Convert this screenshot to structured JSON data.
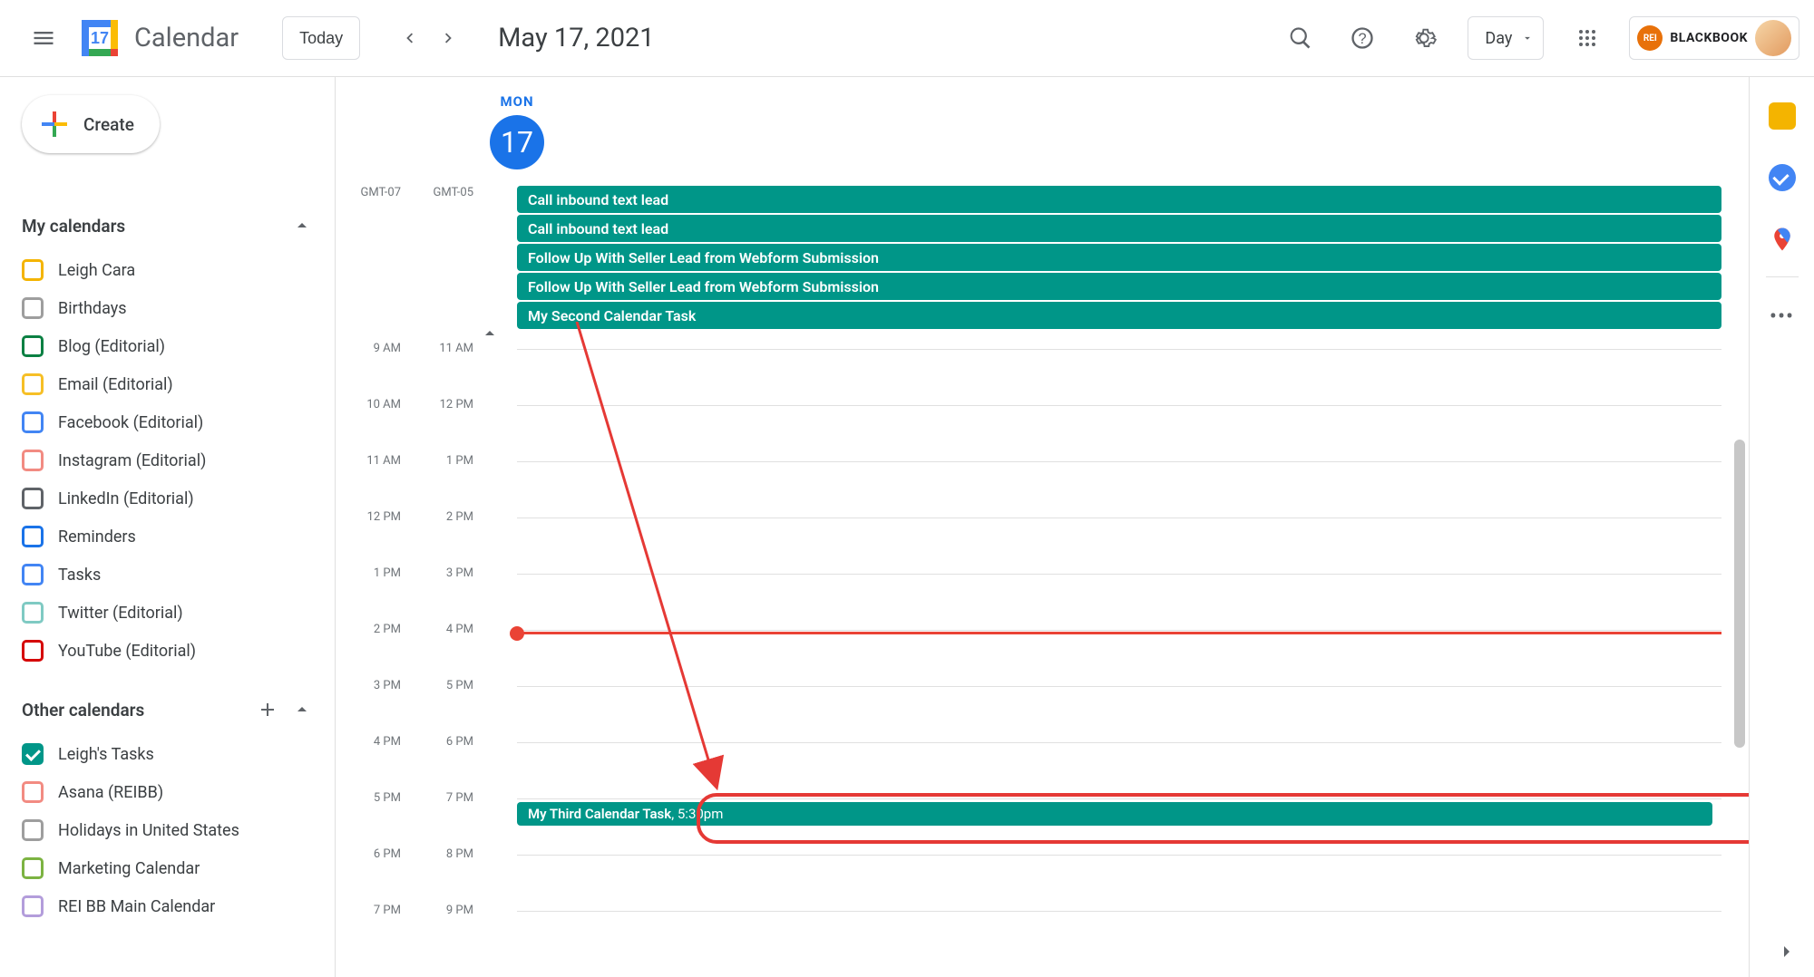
{
  "header": {
    "app_name": "Calendar",
    "today_label": "Today",
    "date_title": "May 17, 2021",
    "view_label": "Day",
    "account_brand": "BLACKBOOK",
    "account_badge": "REI"
  },
  "create_label": "Create",
  "sidebar": {
    "my_calendars_title": "My calendars",
    "other_calendars_title": "Other calendars",
    "my_calendars": [
      {
        "label": "Leigh Cara",
        "color": "#f4b400",
        "checked": false
      },
      {
        "label": "Birthdays",
        "color": "#9e9e9e",
        "checked": false
      },
      {
        "label": "Blog (Editorial)",
        "color": "#0b8043",
        "checked": false
      },
      {
        "label": "Email (Editorial)",
        "color": "#f6bf26",
        "checked": false
      },
      {
        "label": "Facebook (Editorial)",
        "color": "#4285f4",
        "checked": false
      },
      {
        "label": "Instagram (Editorial)",
        "color": "#f28b82",
        "checked": false
      },
      {
        "label": "LinkedIn (Editorial)",
        "color": "#5f6368",
        "checked": false
      },
      {
        "label": "Reminders",
        "color": "#1a73e8",
        "checked": false
      },
      {
        "label": "Tasks",
        "color": "#4285f4",
        "checked": false
      },
      {
        "label": "Twitter (Editorial)",
        "color": "#7fcac3",
        "checked": false
      },
      {
        "label": "YouTube (Editorial)",
        "color": "#d50000",
        "checked": false
      }
    ],
    "other_calendars": [
      {
        "label": "Leigh's Tasks",
        "color": "#009688",
        "checked": true
      },
      {
        "label": "Asana (REIBB)",
        "color": "#f28b82",
        "checked": false
      },
      {
        "label": "Holidays in United States",
        "color": "#9e9e9e",
        "checked": false
      },
      {
        "label": "Marketing Calendar",
        "color": "#7cb342",
        "checked": false
      },
      {
        "label": "REI BB Main Calendar",
        "color": "#b39ddb",
        "checked": false
      }
    ]
  },
  "day": {
    "dow": "MON",
    "dom": "17",
    "tz1": "GMT-07",
    "tz2": "GMT-05",
    "allday_events": [
      "Call inbound text lead",
      "Call inbound text lead",
      "Follow Up With Seller Lead from Webform Submission",
      "Follow Up With Seller Lead from Webform Submission",
      "My Second Calendar Task"
    ],
    "hours_col1": [
      "9 AM",
      "10 AM",
      "11 AM",
      "12 PM",
      "1 PM",
      "2 PM",
      "3 PM",
      "4 PM",
      "5 PM",
      "6 PM",
      "7 PM"
    ],
    "hours_col2": [
      "11 AM",
      "12 PM",
      "1 PM",
      "2 PM",
      "3 PM",
      "4 PM",
      "5 PM",
      "6 PM",
      "7 PM",
      "8 PM",
      "9 PM"
    ],
    "timed_event_title": "My Third Calendar Task",
    "timed_event_time": ", 5:30pm",
    "now_row_index": 5
  }
}
